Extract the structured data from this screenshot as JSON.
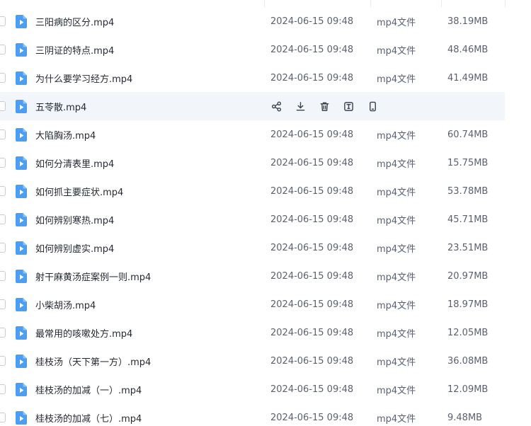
{
  "files": [
    {
      "name": "三阳病的区分.mp4",
      "time": "2024-06-15 09:48",
      "type": "mp4文件",
      "size": "38.19MB"
    },
    {
      "name": "三阴证的特点.mp4",
      "time": "2024-06-15 09:48",
      "type": "mp4文件",
      "size": "48.46MB"
    },
    {
      "name": "为什么要学习经方.mp4",
      "time": "2024-06-15 09:48",
      "type": "mp4文件",
      "size": "41.49MB"
    },
    {
      "name": "五苓散.mp4",
      "hovered": true
    },
    {
      "name": "大陷胸汤.mp4",
      "time": "2024-06-15 09:48",
      "type": "mp4文件",
      "size": "60.74MB"
    },
    {
      "name": "如何分清表里.mp4",
      "time": "2024-06-15 09:48",
      "type": "mp4文件",
      "size": "15.75MB"
    },
    {
      "name": "如何抓主要症状.mp4",
      "time": "2024-06-15 09:48",
      "type": "mp4文件",
      "size": "53.78MB"
    },
    {
      "name": "如何辨别寒热.mp4",
      "time": "2024-06-15 09:48",
      "type": "mp4文件",
      "size": "45.71MB"
    },
    {
      "name": "如何辨别虚实.mp4",
      "time": "2024-06-15 09:48",
      "type": "mp4文件",
      "size": "23.51MB"
    },
    {
      "name": "射干麻黄汤症案例一则.mp4",
      "time": "2024-06-15 09:48",
      "type": "mp4文件",
      "size": "20.97MB"
    },
    {
      "name": "小柴胡汤.mp4",
      "time": "2024-06-15 09:48",
      "type": "mp4文件",
      "size": "18.97MB"
    },
    {
      "name": "最常用的咳嗽处方.mp4",
      "time": "2024-06-15 09:48",
      "type": "mp4文件",
      "size": "12.05MB"
    },
    {
      "name": "桂枝汤（天下第一方）.mp4",
      "time": "2024-06-15 09:48",
      "type": "mp4文件",
      "size": "36.08MB"
    },
    {
      "name": "桂枝汤的加减（一）.mp4",
      "time": "2024-06-15 09:48",
      "type": "mp4文件",
      "size": "12.09MB"
    },
    {
      "name": "桂枝汤的加减（七）.mp4",
      "time": "2024-06-15 09:48",
      "type": "mp4文件",
      "size": "9.48MB"
    }
  ],
  "hover_actions": [
    "share-icon",
    "download-icon",
    "delete-icon",
    "rename-icon",
    "phone-icon"
  ],
  "colors": {
    "file_icon": "#4a9ff5",
    "hover_row": "#f2f5fa",
    "action_icon": "#3b4150"
  }
}
